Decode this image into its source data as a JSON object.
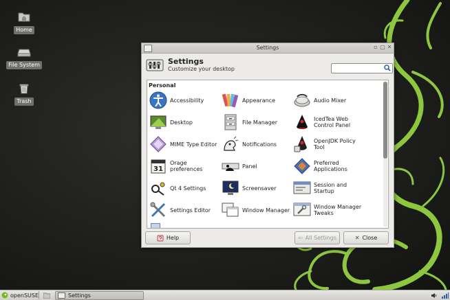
{
  "desktop": {
    "icons": [
      {
        "label": "Home"
      },
      {
        "label": "File System"
      },
      {
        "label": "Trash"
      }
    ]
  },
  "window": {
    "title": "Settings",
    "header_title": "Settings",
    "header_subtitle": "Customize your desktop",
    "search_placeholder": "",
    "category": "Personal",
    "items": [
      {
        "label": "Accessibility",
        "icon": "accessibility-icon"
      },
      {
        "label": "Appearance",
        "icon": "appearance-icon"
      },
      {
        "label": "Audio Mixer",
        "icon": "audio-mixer-icon"
      },
      {
        "label": "Desktop",
        "icon": "desktop-icon"
      },
      {
        "label": "File Manager",
        "icon": "file-manager-icon"
      },
      {
        "label": "IcedTea Web Control Panel",
        "icon": "icedtea-icon"
      },
      {
        "label": "MIME Type Editor",
        "icon": "mime-type-icon"
      },
      {
        "label": "Notifications",
        "icon": "notifications-icon"
      },
      {
        "label": "OpenJDK Policy Tool",
        "icon": "openjdk-icon"
      },
      {
        "label": "Orage preferences",
        "icon": "calendar-icon"
      },
      {
        "label": "Panel",
        "icon": "panel-icon"
      },
      {
        "label": "Preferred Applications",
        "icon": "preferred-apps-icon"
      },
      {
        "label": "Qt 4 Settings",
        "icon": "qt-settings-icon"
      },
      {
        "label": "Screensaver",
        "icon": "screensaver-icon"
      },
      {
        "label": "Session and Startup",
        "icon": "session-icon"
      },
      {
        "label": "Settings Editor",
        "icon": "settings-editor-icon"
      },
      {
        "label": "Window Manager",
        "icon": "window-manager-icon"
      },
      {
        "label": "Window Manager Tweaks",
        "icon": "wm-tweaks-icon"
      }
    ],
    "buttons": {
      "help": "Help",
      "all_settings": "All Settings",
      "close": "Close"
    }
  },
  "taskbar": {
    "menu_label": "openSUSE",
    "task_label": "Settings"
  },
  "colors": {
    "accent_green": "#8ec63f",
    "desktop_bg": "#1e1f1d"
  }
}
